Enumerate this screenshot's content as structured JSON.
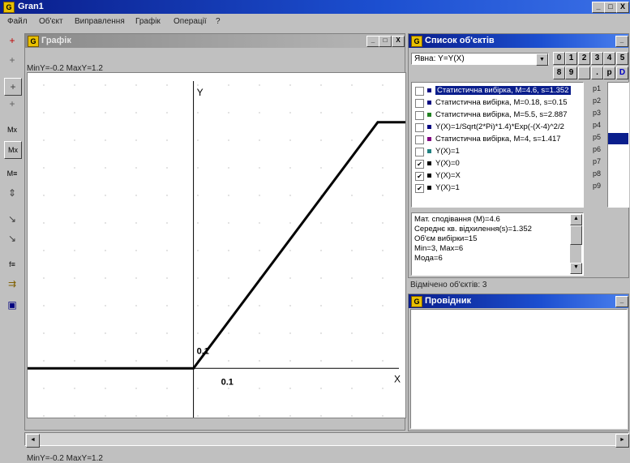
{
  "app": {
    "title": "Gran1",
    "icon_letter": "G",
    "min_label": "_",
    "max_label": "□",
    "close_label": "X"
  },
  "menu": [
    "Файл",
    "Об'єкт",
    "Виправлення",
    "Графік",
    "Операції",
    "?"
  ],
  "toolbar": [
    "+",
    "+",
    "+",
    "+",
    "Mx",
    "Mx",
    "M≡",
    "⇕",
    "↘",
    "↘",
    "f≡",
    "⇉",
    "▣"
  ],
  "graph_window": {
    "title": "Графік",
    "min_label": "_",
    "max_label": "□",
    "close_label": "X",
    "status_top": "MinY=-0.2  MaxY=1.2",
    "status_bottom": "MinY=-0.2  MaxY=1.2",
    "y_axis_label": "Y",
    "x_axis_label": "X",
    "y_tick": "0.1",
    "x_tick": "0.1"
  },
  "chart_data": {
    "type": "line",
    "series": [
      {
        "values": [
          [
            -0.9,
            0
          ],
          [
            0,
            0
          ],
          [
            1.0,
            1.0
          ],
          [
            1.5,
            1.0
          ]
        ]
      }
    ],
    "xlim": [
      -0.9,
      1.15
    ],
    "ylim": [
      -0.2,
      1.2
    ]
  },
  "object_list": {
    "title": "Список об'єктів",
    "function_select": "Явна: Y=Y(X)",
    "num_buttons_row1": [
      "0",
      "1",
      "2",
      "3",
      "4",
      "5"
    ],
    "num_buttons_row2": [
      "8",
      "9",
      "",
      ".",
      "p",
      "D"
    ],
    "items": [
      {
        "label": "Статистична вибірка, M=4.6, s=1.352",
        "checked": false,
        "color": "#000080",
        "selected": true,
        "param": "p1"
      },
      {
        "label": "Статистична вибірка, M=0.18, s=0.15",
        "checked": false,
        "color": "#000080",
        "selected": false,
        "param": "p2"
      },
      {
        "label": "Статистична вибірка, M=5.5, s=2.887",
        "checked": false,
        "color": "#208020",
        "selected": false,
        "param": "p3"
      },
      {
        "label": "Y(X)=1/Sqrt(2*Pi)*1.4)*Exp(-(X-4)^2/2",
        "checked": false,
        "color": "#000080",
        "selected": false,
        "param": "p4"
      },
      {
        "label": "Статистична вибірка, M=4, s=1.417",
        "checked": false,
        "color": "#800080",
        "selected": false,
        "param": "p5"
      },
      {
        "label": "Y(X)=1",
        "checked": false,
        "color": "#208080",
        "selected": false,
        "param": "p6"
      },
      {
        "label": "Y(X)=0",
        "checked": true,
        "color": "#000000",
        "selected": false,
        "param": "p7"
      },
      {
        "label": "Y(X)=X",
        "checked": true,
        "color": "#000000",
        "selected": false,
        "param": "p8"
      },
      {
        "label": "Y(X)=1",
        "checked": true,
        "color": "#000000",
        "selected": false,
        "param": "p9"
      }
    ],
    "check_mark": "✔",
    "info_lines": [
      "Мат. сподівання (M)=4.6",
      "Середнє кв. відхилення(s)=1.352",
      "Об'єм вибірки=15",
      "Min=3, Max=6",
      "Мода=6"
    ],
    "selected_count": "Відмічено об'єктів: 3"
  },
  "explorer_window": {
    "title": "Провідник",
    "min_label": "_"
  },
  "scroll": {
    "left": "◄",
    "right": "►",
    "up": "▲",
    "down": "▼",
    "select_arrow": "▼"
  }
}
